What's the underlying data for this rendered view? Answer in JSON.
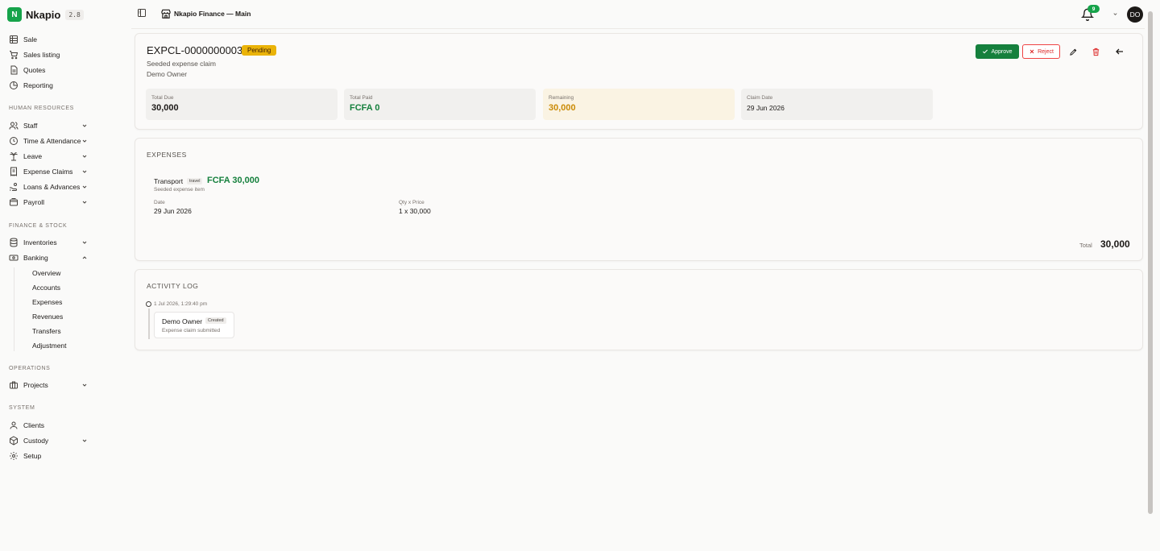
{
  "brand": {
    "logo_letter": "N",
    "name": "Nkapio",
    "version": "2.8"
  },
  "nav": {
    "main": [
      {
        "label": "Sale",
        "icon": "grid-icon"
      },
      {
        "label": "Sales listing",
        "icon": "cart-icon"
      },
      {
        "label": "Quotes",
        "icon": "document-icon"
      },
      {
        "label": "Reporting",
        "icon": "pie-chart-icon"
      }
    ],
    "sections": {
      "hr": "HUMAN RESOURCES",
      "finance": "FINANCE & STOCK",
      "operations": "OPERATIONS",
      "system": "SYSTEM"
    },
    "hr": [
      {
        "label": "Staff",
        "icon": "users-icon"
      },
      {
        "label": "Time & Attendance",
        "icon": "clock-icon"
      },
      {
        "label": "Leave",
        "icon": "palm-tree-icon"
      },
      {
        "label": "Expense Claims",
        "icon": "receipt-icon"
      },
      {
        "label": "Loans & Advances",
        "icon": "hand-coins-icon"
      },
      {
        "label": "Payroll",
        "icon": "wallet-icon"
      }
    ],
    "finance": [
      {
        "label": "Inventories",
        "icon": "database-icon"
      },
      {
        "label": "Banking",
        "icon": "banknote-icon"
      }
    ],
    "banking_sub": [
      "Overview",
      "Accounts",
      "Expenses",
      "Revenues",
      "Transfers",
      "Adjustment"
    ],
    "operations": [
      {
        "label": "Projects",
        "icon": "briefcase-icon"
      }
    ],
    "system": [
      {
        "label": "Clients",
        "icon": "user-icon"
      },
      {
        "label": "Custody",
        "icon": "box-icon"
      },
      {
        "label": "Setup",
        "icon": "gear-icon"
      }
    ]
  },
  "topbar": {
    "title": "Nkapio Finance — Main",
    "notification_count": "9",
    "avatar_initials": "DO"
  },
  "claim": {
    "id": "EXPCL-0000000003",
    "status": "Pending",
    "description": "Seeded expense claim",
    "owner": "Demo Owner",
    "approve_label": "Approve",
    "reject_label": "Reject",
    "stats": {
      "total_due": {
        "label": "Total Due",
        "value": "30,000"
      },
      "total_paid": {
        "label": "Total Paid",
        "value": "FCFA 0"
      },
      "remaining": {
        "label": "Remaining",
        "value": "30,000"
      },
      "claim_date": {
        "label": "Claim Date",
        "value": "29 Jun 2026"
      }
    }
  },
  "expenses": {
    "title": "EXPENSES",
    "items": [
      {
        "name": "Transport",
        "tag": "travel",
        "amount": "FCFA 30,000",
        "description": "Seeded expense item",
        "date_label": "Date",
        "date": "29 Jun 2026",
        "qty_label": "Qty x Price",
        "qty": "1 x 30,000"
      }
    ],
    "total_label": "Total",
    "total_value": "30,000"
  },
  "activity": {
    "title": "ACTIVITY LOG",
    "entries": [
      {
        "time": "1 Jul 2026, 1:29:40 pm",
        "user": "Demo Owner",
        "action": "Created",
        "description": "Expense claim submitted"
      }
    ]
  },
  "colors": {
    "accent": "#16a34a",
    "pending": "#eab308",
    "danger": "#dc2626",
    "warning_text": "#ca8a04"
  }
}
